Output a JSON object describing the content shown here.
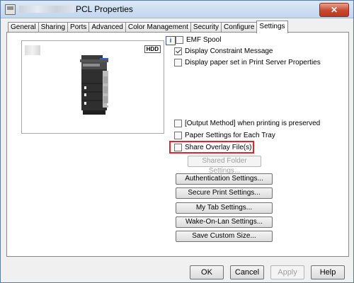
{
  "window": {
    "title": "PCL Properties",
    "close_glyph": "✕"
  },
  "tabs": [
    {
      "label": "General"
    },
    {
      "label": "Sharing"
    },
    {
      "label": "Ports"
    },
    {
      "label": "Advanced"
    },
    {
      "label": "Color Management"
    },
    {
      "label": "Security"
    },
    {
      "label": "Configure"
    },
    {
      "label": "Settings",
      "active": true
    }
  ],
  "preview": {
    "hdd_label": "HDD",
    "info_icon": "i"
  },
  "options": {
    "emf_spool": {
      "label": "EMF Spool",
      "checked": false
    },
    "display_constraint": {
      "label": "Display Constraint Message",
      "checked": true
    },
    "display_paper_set": {
      "label": "Display paper set in Print Server Properties",
      "checked": false
    },
    "output_method": {
      "label": "[Output Method] when printing is preserved",
      "checked": false
    },
    "paper_each_tray": {
      "label": "Paper Settings for Each Tray",
      "checked": false
    },
    "share_overlay": {
      "label": "Share Overlay File(s)",
      "checked": false
    }
  },
  "buttons": {
    "shared_folder": "Shared Folder Settings...",
    "authentication": "Authentication Settings...",
    "secure_print": "Secure Print Settings...",
    "my_tab": "My Tab Settings...",
    "wake_on_lan": "Wake-On-Lan Settings...",
    "save_custom": "Save Custom Size...",
    "ok": "OK",
    "cancel": "Cancel",
    "apply": "Apply",
    "help": "Help"
  },
  "colors": {
    "highlight": "#e4232b",
    "close_button": "#c9482f"
  },
  "icons": {
    "title": "printer-app-icon",
    "info": "info-icon",
    "close": "close-icon"
  }
}
